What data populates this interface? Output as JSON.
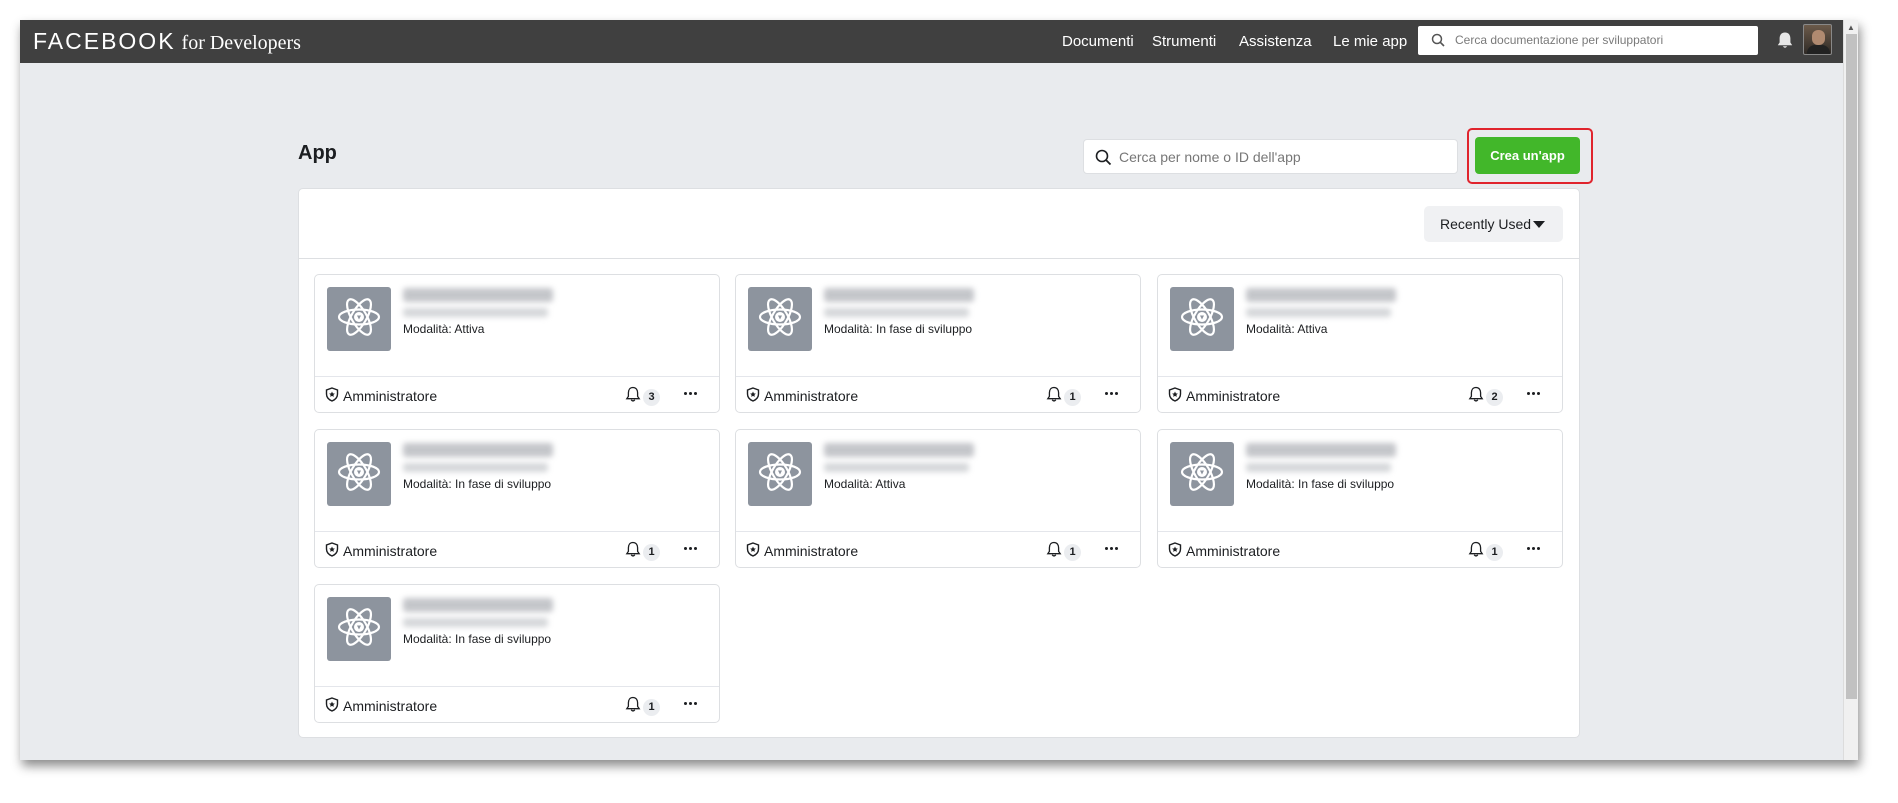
{
  "topbar": {
    "logo_main": "FACEBOOK",
    "logo_sub": "for Developers",
    "nav": [
      "Documenti",
      "Strumenti",
      "Assistenza",
      "Le mie app"
    ],
    "search_placeholder": "Cerca documentazione per sviluppatori"
  },
  "page": {
    "title": "App",
    "search_placeholder": "Cerca per nome o ID dell'app",
    "create_button": "Crea un'app",
    "sort_label": "Recently Used"
  },
  "apps": [
    {
      "mode": "Modalità: Attiva",
      "role": "Amministratore",
      "notifications": "3"
    },
    {
      "mode": "Modalità: In fase di sviluppo",
      "role": "Amministratore",
      "notifications": "1"
    },
    {
      "mode": "Modalità: Attiva",
      "role": "Amministratore",
      "notifications": "2"
    },
    {
      "mode": "Modalità: In fase di sviluppo",
      "role": "Amministratore",
      "notifications": "1"
    },
    {
      "mode": "Modalità: Attiva",
      "role": "Amministratore",
      "notifications": "1"
    },
    {
      "mode": "Modalità: In fase di sviluppo",
      "role": "Amministratore",
      "notifications": "1"
    },
    {
      "mode": "Modalità: In fase di sviluppo",
      "role": "Amministratore",
      "notifications": "1"
    }
  ],
  "colors": {
    "topbar": "#404040",
    "page_bg": "#e9ebee",
    "create_button": "#42b72a",
    "highlight_outline": "#e0242d",
    "app_icon_bg": "#8d949e"
  },
  "icons": {
    "search": "search-icon",
    "bell": "bell-icon",
    "app": "atom-icon",
    "role": "shield-icon",
    "more": "more-horizontal-icon",
    "sort": "caret-down-icon"
  }
}
